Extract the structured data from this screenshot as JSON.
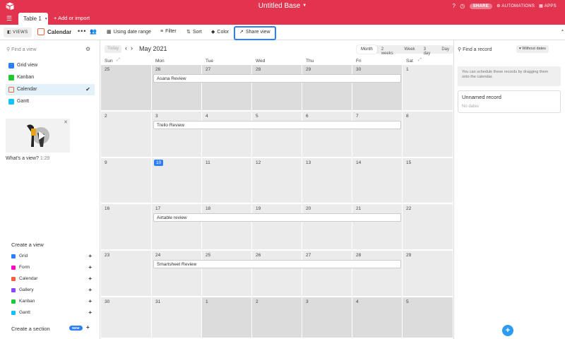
{
  "header": {
    "base_title": "Untitled Base",
    "share": "SHARE",
    "automations": "AUTOMATIONS",
    "apps": "APPS"
  },
  "tabs": {
    "table": "Table 1",
    "add_import": "Add or import"
  },
  "toolbar": {
    "views": "VIEWS",
    "view_name": "Calendar",
    "date_range": "Using date range",
    "filter": "Filter",
    "sort": "Sort",
    "color": "Color",
    "share_view": "Share view"
  },
  "sidebar": {
    "find_placeholder": "Find a view",
    "views": [
      {
        "label": "Grid view",
        "color": "#2d7ff9"
      },
      {
        "label": "Kanban",
        "color": "#20c933"
      },
      {
        "label": "Calendar",
        "color": "#f0643c",
        "active": true
      },
      {
        "label": "Gantt",
        "color": "#18bfff"
      }
    ],
    "video_caption": "What's a view?",
    "video_duration": "1:29",
    "create_view": "Create a view",
    "create_items": [
      {
        "label": "Grid",
        "color": "#2d7ff9"
      },
      {
        "label": "Form",
        "color": "#ff08c2"
      },
      {
        "label": "Calendar",
        "color": "#f0643c"
      },
      {
        "label": "Gallery",
        "color": "#8b46ff"
      },
      {
        "label": "Kanban",
        "color": "#20c933"
      },
      {
        "label": "Gantt",
        "color": "#18bfff"
      }
    ],
    "create_section": "Create a section",
    "new_badge": "NEW"
  },
  "calendar": {
    "today": "Today",
    "month": "May 2021",
    "ranges": [
      "Month",
      "2 weeks",
      "Week",
      "3 day",
      "Day"
    ],
    "selected_range": "Month",
    "weekdays": [
      "Sun",
      "Mon",
      "Tue",
      "Wed",
      "Thu",
      "Fri",
      "Sat"
    ],
    "weeks": [
      [
        "25",
        "26",
        "27",
        "28",
        "29",
        "30",
        "1"
      ],
      [
        "2",
        "3",
        "4",
        "5",
        "6",
        "7",
        "8"
      ],
      [
        "9",
        "10",
        "11",
        "12",
        "13",
        "14",
        "15"
      ],
      [
        "16",
        "17",
        "18",
        "19",
        "20",
        "21",
        "22"
      ],
      [
        "23",
        "24",
        "25",
        "26",
        "27",
        "28",
        "29"
      ],
      [
        "30",
        "31",
        "1",
        "2",
        "3",
        "4",
        "5"
      ]
    ],
    "today_date": "10",
    "events": [
      {
        "title": "Asana Review",
        "week": 0
      },
      {
        "title": "Trello Review",
        "week": 1
      },
      {
        "title": "Airtable review",
        "week": 3
      },
      {
        "title": "Smartsheet Review",
        "week": 4
      }
    ]
  },
  "right_panel": {
    "find_record": "Find a record",
    "without_dates": "Without dates",
    "note": "You can schedule these records by dragging them onto the calendar.",
    "record_title": "Unnamed record",
    "record_sub": "No dates"
  }
}
